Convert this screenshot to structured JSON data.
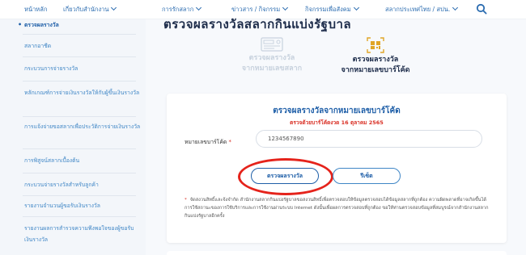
{
  "nav": {
    "home": "หน้าหลัก",
    "about": "เกี่ยวกับสำนักงาน",
    "lottery": "การรักสลาก",
    "news": "ข่าวสาร / กิจกรรม",
    "social": "กิจกรรมเพื่อสังคม",
    "office": "สลากประเทศไทย / สปน."
  },
  "sidebar": {
    "items": [
      "ตรวจผลรางวัล",
      "สลากอาชีด",
      "กระบวนการจ่ายรางวัล",
      "หลักเกณฑ์การจ่ายเงินรางวัลให้กับผู้ขึ้นเงินรางวัล",
      "การแจ้งจ่ายขอสลากเพื่อประวัติการจ่ายเงินรางวัล",
      "การพิสูจน์สลากเบื้องต้น",
      "กระบวนจ่ายรางวัลสำหรับลูกค้า",
      "รายงานจำนวนผู้ขอรับเงินรางวัล",
      "รายงานผลการสำรวจความพึงพอใจของผู้ขอรับเงินรางวัล"
    ]
  },
  "main": {
    "page_title": "ตรวจผลรางวัลสลากกินแบ่งรัฐบาล",
    "tabs": [
      {
        "line1": "ตรวจผลรางวัล",
        "line2": "จากหมายเลขสลาก"
      },
      {
        "line1": "ตรวจผลรางวัล",
        "line2": "จากหมายเลขบาร์โค้ด"
      }
    ],
    "card": {
      "title": "ตรวจผลรางวัลจากหมายเลขบาร์โค้ด",
      "subtitle": "ตรวจด้วยบาร์โค้ดงวด 16 ตุลาคม 2565",
      "field_label": "หมายเลขบาร์โค้ด",
      "required_mark": "*",
      "input_value": "1234567890",
      "check_button": "ตรวจผลรางวัล",
      "reset_button": "รีเซ็ต",
      "note": "จัดสงวนสิทธิ์และจ้งจำกัด สำนักงานสลากกินแบ่งรัฐบาลขอสงวนสิทธิ์เพื่อตรวจสอบให้ข้อมูลตรวจสอบได้ข้อมูลสลากที่ถูกต้อง ความผิดพลาดที่อาจเกิดขึ้นได้ การใช้สถานะของการใช้บริการและการใช้งานผ่านระบบ Internet ดังนั้นเพื่อผลการตรวจสอบที่ถูกต้อง ขอให้ท่านตรวจสอบข้อมูลที่สมบูรณ์จากสำนักงานสลากกินแบ่งรัฐบาลอีกครั้ง"
    }
  },
  "colors": {
    "accent": "#1f5fa8",
    "link": "#3f86c6",
    "alert": "#d93025",
    "highlight": "#e5231b"
  }
}
